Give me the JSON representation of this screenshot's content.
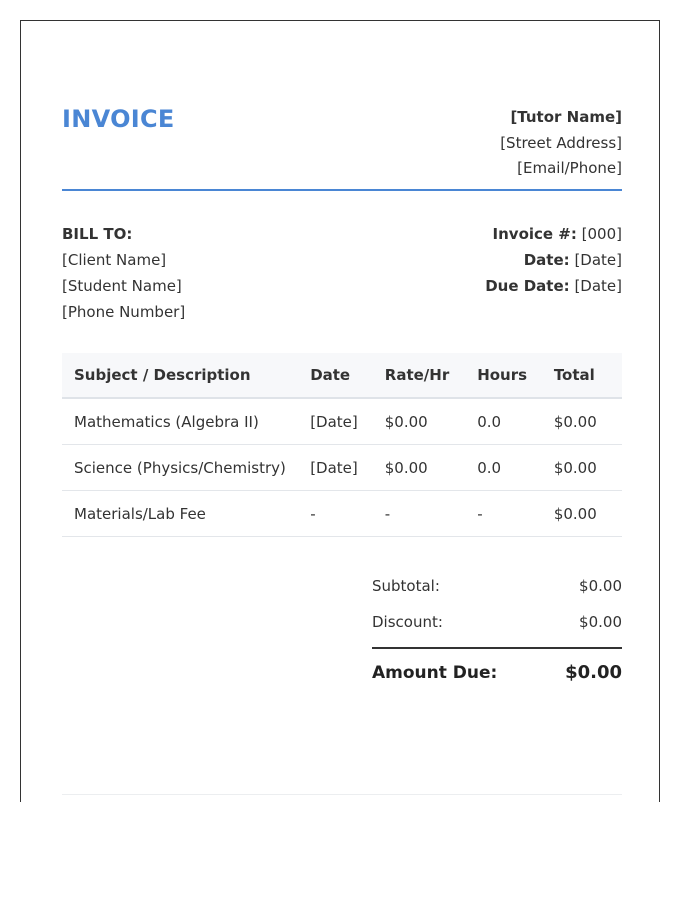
{
  "header": {
    "title": "INVOICE",
    "tutor_name": "[Tutor Name]",
    "street_address": "[Street Address]",
    "email_phone": "[Email/Phone]"
  },
  "bill_to": {
    "label": "BILL TO:",
    "client_name": "[Client Name]",
    "student_name": "[Student Name]",
    "phone_number": "[Phone Number]"
  },
  "meta": {
    "invoice_label": "Invoice #:",
    "invoice_value": "[000]",
    "date_label": "Date:",
    "date_value": "[Date]",
    "due_label": "Due Date:",
    "due_value": "[Date]"
  },
  "table": {
    "headers": [
      "Subject / Description",
      "Date",
      "Rate/Hr",
      "Hours",
      "Total"
    ],
    "rows": [
      [
        "Mathematics (Algebra II)",
        "[Date]",
        "$0.00",
        "0.0",
        "$0.00"
      ],
      [
        "Science (Physics/Chemistry)",
        "[Date]",
        "$0.00",
        "0.0",
        "$0.00"
      ],
      [
        "Materials/Lab Fee",
        "-",
        "-",
        "-",
        "$0.00"
      ]
    ]
  },
  "totals": {
    "subtotal_label": "Subtotal:",
    "subtotal_value": "$0.00",
    "discount_label": "Discount:",
    "discount_value": "$0.00",
    "amount_due_label": "Amount Due:",
    "amount_due_value": "$0.00"
  },
  "colors": {
    "accent": "#4a86d4",
    "text": "#333333",
    "table_header_bg": "#f7f8fa"
  }
}
